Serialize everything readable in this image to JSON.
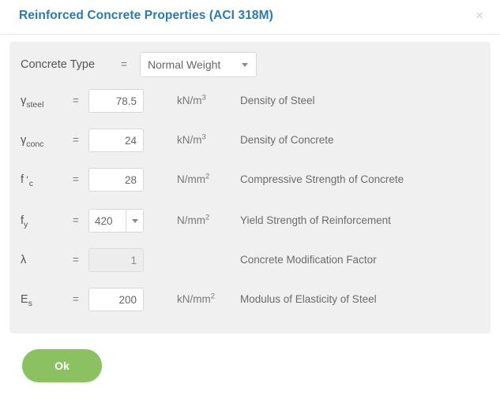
{
  "dialog": {
    "title": "Reinforced Concrete Properties (ACI 318M)",
    "close_label": "×"
  },
  "concrete_type": {
    "label": "Concrete Type",
    "equals": "=",
    "value": "Normal Weight",
    "caret": "chevron-down-icon"
  },
  "properties": [
    {
      "symbol_base": "γ",
      "symbol_sub": "steel",
      "equals": "=",
      "value": "78.5",
      "unit_base": "kN/m",
      "unit_sup": "3",
      "description": "Density of Steel",
      "control": "input",
      "disabled": false
    },
    {
      "symbol_base": "γ",
      "symbol_sub": "conc",
      "equals": "=",
      "value": "24",
      "unit_base": "kN/m",
      "unit_sup": "3",
      "description": "Density of Concrete",
      "control": "input",
      "disabled": false
    },
    {
      "symbol_base": "f '",
      "symbol_sub": "c",
      "equals": "=",
      "value": "28",
      "unit_base": "N/mm",
      "unit_sup": "2",
      "description": "Compressive Strength of Concrete",
      "control": "input",
      "disabled": false
    },
    {
      "symbol_base": "f",
      "symbol_sub": "y",
      "equals": "=",
      "value": "420",
      "unit_base": "N/mm",
      "unit_sup": "2",
      "description": "Yield Strength of Reinforcement",
      "control": "combo",
      "disabled": false
    },
    {
      "symbol_base": "λ",
      "symbol_sub": "",
      "equals": "=",
      "value": "1",
      "unit_base": "",
      "unit_sup": "",
      "description": "Concrete Modification Factor",
      "control": "input",
      "disabled": true
    },
    {
      "symbol_base": "E",
      "symbol_sub": "s",
      "equals": "=",
      "value": "200",
      "unit_base": "kN/mm",
      "unit_sup": "2",
      "description": "Modulus of Elasticity of Steel",
      "control": "input",
      "disabled": false
    }
  ],
  "footer": {
    "ok_label": "Ok"
  },
  "colors": {
    "title": "#2a7ab0",
    "panel_bg": "#f0f0f0",
    "ok_button": "#8cc162",
    "text": "#666666"
  }
}
